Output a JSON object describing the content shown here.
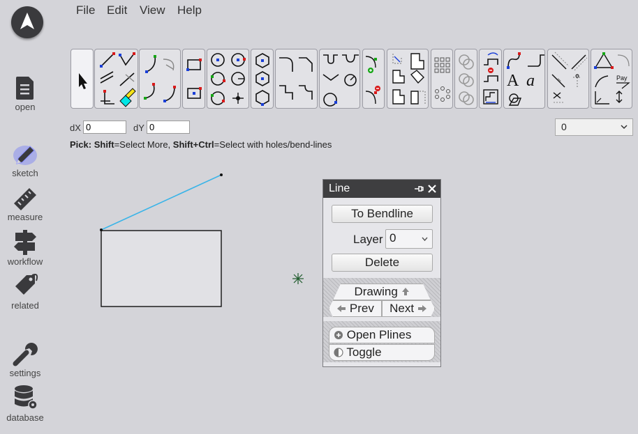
{
  "menu": {
    "file": "File",
    "edit": "Edit",
    "view": "View",
    "help": "Help"
  },
  "nav": {
    "open": "open",
    "sketch": "sketch",
    "measure": "measure",
    "workflow": "workflow",
    "related": "related",
    "settings": "settings",
    "database": "database"
  },
  "inputs": {
    "dx_label": "dX",
    "dx_value": "0",
    "dy_label": "dY",
    "dy_value": "0",
    "layer_select_value": "0"
  },
  "hint": {
    "pick": "Pick",
    "colon": ": ",
    "shift": "Shift",
    "select_more": "=Select More, ",
    "shift_ctrl": "Shift+Ctrl",
    "select_holes": "=Select with holes/bend-lines"
  },
  "panel": {
    "title": "Line",
    "to_bendline": "To Bendline",
    "layer_label": "Layer",
    "layer_value": "0",
    "delete": "Delete",
    "drawing": "Drawing",
    "prev": "Prev",
    "next": "Next",
    "open_plines": "Open Plines",
    "toggle": "Toggle"
  },
  "colors": {
    "accent_line": "#3ab4e8",
    "background": "#d4d4d9",
    "panel_header": "#3e3e40",
    "sketch_glow": "#4f5bff"
  }
}
